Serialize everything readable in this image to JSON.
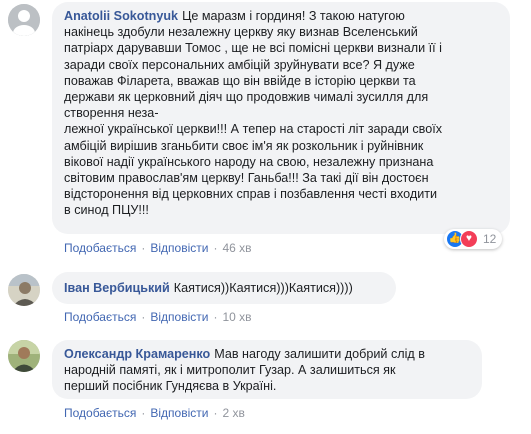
{
  "comments": [
    {
      "author": "Anatolii Sokotnyuk",
      "text_lines": [
        "Це маразм і гординя! З такою натугою",
        "накінець здобули незалежну церкву яку визнав Вселенський",
        "патріарх дарувавши Томос , ще не всі помісні церкви визнали її і",
        "заради своїх персональних амбіцій зруйнувати все? Я дуже",
        "поважав Філарета, вважав що він ввійде в історію церкви та",
        "держави як церковний діяч що продовжив чималі зусилля для",
        "створення неза-",
        "лежної української церкви!!! А тепер на старості літ заради своїх",
        "амбіцій вирішив зганьбити своє ім'я як розкольник і руйнівник",
        "вікової надії українського народу на свою, незалежну признана",
        "світовим православ'ям церкву! Ганьба!!! За такі дії він достоєн",
        "відсторонення від церковних справ і позбавлення честі входити",
        "в синод ПЦУ!!!"
      ],
      "like_label": "Подобається",
      "reply_label": "Відповісти",
      "time": "46 хв",
      "reactions": {
        "count": "12",
        "icons": [
          "like-icon",
          "love-icon"
        ]
      }
    },
    {
      "author": "Іван Вербицький",
      "text": "Каятися))Каятися)))Каятися))))",
      "like_label": "Подобається",
      "reply_label": "Відповісти",
      "time": "10 хв"
    },
    {
      "author": "Олександр Крамаренко",
      "text_lines": [
        "Мав нагоду залишити добрий слід в",
        "народній памяті, як і митрополит Гузар. А залишиться як",
        "перший посібник Гундяєва в Україні."
      ],
      "like_label": "Подобається",
      "reply_label": "Відповісти",
      "time": "2 хв"
    }
  ],
  "colors": {
    "link": "#4267b2",
    "author": "#385898",
    "bubble": "#f2f3f5",
    "meta": "#90949c"
  }
}
